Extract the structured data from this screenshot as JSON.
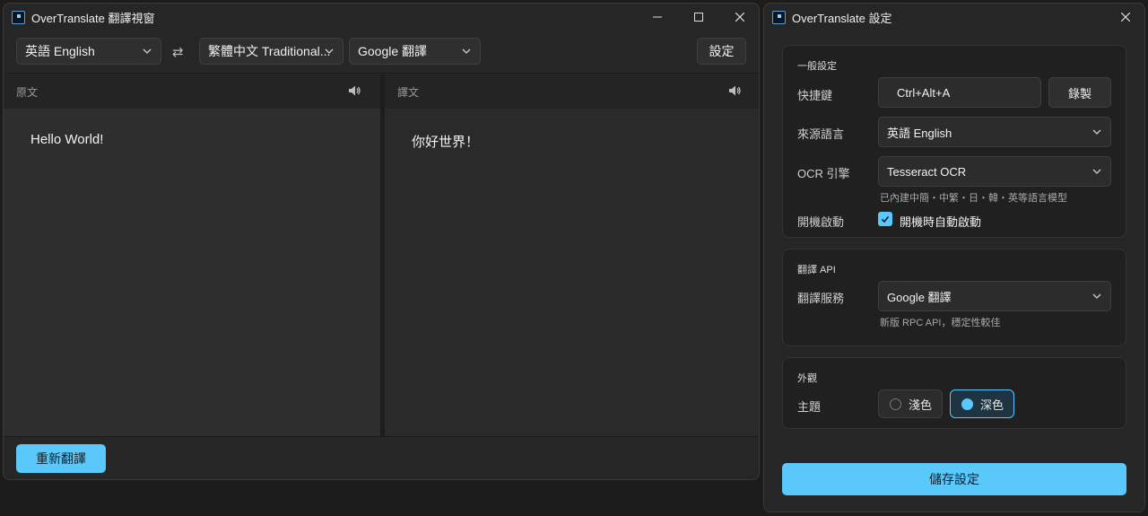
{
  "main_window": {
    "title": "OverTranslate 翻譯視窗",
    "source_language": "英語 English",
    "swap_symbol": "⇄",
    "target_language": "繁體中文 Traditional...",
    "engine": "Google 翻譯",
    "settings_button": "設定",
    "source_pane": {
      "header": "原文",
      "text": "Hello World!"
    },
    "target_pane": {
      "header": "譯文",
      "text": "你好世界！"
    },
    "retranslate_button": "重新翻譯"
  },
  "settings_window": {
    "title": "OverTranslate 設定",
    "general": {
      "title": "一般設定",
      "hotkey_label": "快捷鍵",
      "hotkey_value": "Ctrl+Alt+A",
      "record_button": "錄製",
      "source_lang_label": "來源語言",
      "source_lang_value": "英語 English",
      "ocr_label": "OCR 引擎",
      "ocr_value": "Tesseract OCR",
      "ocr_hint": "已內建中簡・中繁・日・韓・英等語言模型",
      "startup_label": "開機啟動",
      "startup_checkbox_label": "開機時自動啟動",
      "startup_checked": true
    },
    "translate_api": {
      "title": "翻譯 API",
      "service_label": "翻譯服務",
      "service_value": "Google 翻譯",
      "service_hint": "新版 RPC API，穩定性較佳"
    },
    "appearance": {
      "title": "外觀",
      "theme_label": "主題",
      "light_label": "淺色",
      "dark_label": "深色",
      "selected": "dark"
    },
    "save_button": "儲存設定"
  },
  "colors": {
    "accent": "#5ac8fa",
    "window_bg": "#262626",
    "pane_bg": "#2e2e2e"
  },
  "icons": {
    "minimize": "minimize-icon",
    "maximize": "maximize-icon",
    "close": "close-icon",
    "speaker": "speaker-icon",
    "chevron": "chevron-down-icon",
    "check": "checkmark-icon"
  }
}
